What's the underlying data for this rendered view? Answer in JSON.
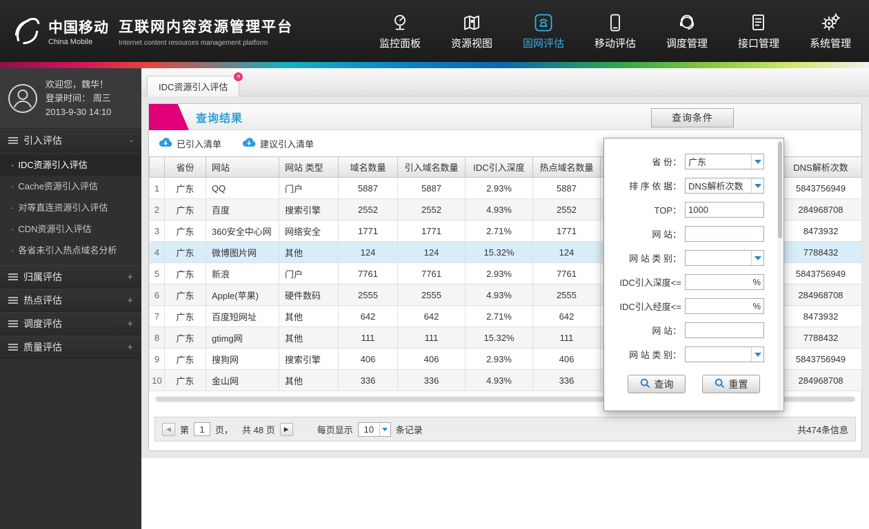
{
  "colors": {
    "accent_blue": "#2e9fd4",
    "accent_magenta": "#e2007a",
    "nav_active": "#36b3e6",
    "selected_row_bg": "#d9edf8"
  },
  "header": {
    "brand_cn": "中国移动",
    "brand_en": "China Mobile",
    "title_cn": "互联网内容资源管理平台",
    "title_en": "Internet content resources management platform",
    "nav": [
      {
        "label": "监控面板",
        "icon": "dashboard-icon",
        "active": false
      },
      {
        "label": "资源视图",
        "icon": "map-icon",
        "active": false
      },
      {
        "label": "固网评估",
        "icon": "phone-icon",
        "active": true
      },
      {
        "label": "移动评估",
        "icon": "mobile-icon",
        "active": false
      },
      {
        "label": "调度管理",
        "icon": "headset-icon",
        "active": false
      },
      {
        "label": "接口管理",
        "icon": "document-icon",
        "active": false
      },
      {
        "label": "系统管理",
        "icon": "gears-icon",
        "active": false
      }
    ]
  },
  "sidebar": {
    "user": {
      "welcome": "欢迎您，魏华！",
      "login_line1": "登录时间：  周三",
      "login_line2": "2013-9-30  14:10"
    },
    "sections": [
      {
        "label": "引入评估",
        "toggle": "-",
        "expanded": true,
        "items": [
          {
            "label": "IDC资源引入评估",
            "active": true
          },
          {
            "label": "Cache资源引入评估",
            "active": false
          },
          {
            "label": "对等直连资源引入评估",
            "active": false
          },
          {
            "label": "CDN资源引入评估",
            "active": false
          },
          {
            "label": "各省未引入热点域名分析",
            "active": false
          }
        ]
      },
      {
        "label": "归属评估",
        "toggle": "+",
        "expanded": false,
        "items": []
      },
      {
        "label": "热点评估",
        "toggle": "+",
        "expanded": false,
        "items": []
      },
      {
        "label": "调度评估",
        "toggle": "+",
        "expanded": false,
        "items": []
      },
      {
        "label": "质量评估",
        "toggle": "+",
        "expanded": false,
        "items": []
      }
    ]
  },
  "tabbar": {
    "tabs": [
      {
        "label": "IDC资源引入评估",
        "active": true,
        "closable": true
      }
    ]
  },
  "panel": {
    "title": "查询结果",
    "query_toggle_label": "查询条件",
    "toolbar_buttons": [
      {
        "label": "已引入清单",
        "icon": "cloud-download-icon"
      },
      {
        "label": "建议引入清单",
        "icon": "cloud-download-icon"
      }
    ]
  },
  "table": {
    "columns": [
      "",
      "省份",
      "网站",
      "网站 类型",
      "域名数量",
      "引入域名数量",
      "IDC引入深度",
      "热点域名数量",
      "",
      "DNS解析次数"
    ],
    "selected_index": 3,
    "rows": [
      [
        "1",
        "广东",
        "QQ",
        "门户",
        "5887",
        "5887",
        "2.93%",
        "5887",
        "",
        "5843756949"
      ],
      [
        "2",
        "广东",
        "百度",
        "搜索引擎",
        "2552",
        "2552",
        "4.93%",
        "2552",
        "",
        "284968708"
      ],
      [
        "3",
        "广东",
        "360安全中心网",
        "网络安全",
        "1771",
        "1771",
        "2.71%",
        "1771",
        "",
        "8473932"
      ],
      [
        "4",
        "广东",
        "微博图片网",
        "其他",
        "124",
        "124",
        "15.32%",
        "124",
        "",
        "7788432"
      ],
      [
        "5",
        "广东",
        "新浪",
        "门户",
        "7761",
        "7761",
        "2.93%",
        "7761",
        "",
        "5843756949"
      ],
      [
        "6",
        "广东",
        "Apple(苹果)",
        "硬件数码",
        "2555",
        "2555",
        "4.93%",
        "2555",
        "",
        "284968708"
      ],
      [
        "7",
        "广东",
        "百度短网址",
        "其他",
        "642",
        "642",
        "2.71%",
        "642",
        "",
        "8473932"
      ],
      [
        "8",
        "广东",
        "gtimg网",
        "其他",
        "111",
        "111",
        "15.32%",
        "111",
        "",
        "7788432"
      ],
      [
        "9",
        "广东",
        "搜狗网",
        "搜索引擎",
        "406",
        "406",
        "2.93%",
        "406",
        "",
        "5843756949"
      ],
      [
        "10",
        "广东",
        "金山网",
        "其他",
        "336",
        "336",
        "4.93%",
        "336",
        "",
        "284968708"
      ]
    ]
  },
  "query_panel": {
    "fields": [
      {
        "label": "省 份：",
        "type": "select",
        "value": "广东"
      },
      {
        "label": "排 序 依 据：",
        "type": "select",
        "value": "DNS解析次数"
      },
      {
        "label": "TOP：",
        "type": "input",
        "value": "1000"
      },
      {
        "label": "网 站：",
        "type": "input",
        "value": ""
      },
      {
        "label": "网 站 类 别：",
        "type": "select",
        "value": ""
      },
      {
        "label": "IDC引入深度<=",
        "type": "input",
        "value": "",
        "suffix": "%"
      },
      {
        "label": "IDC引入经度<=",
        "type": "input",
        "value": "",
        "suffix": "%"
      },
      {
        "label": "网 站：",
        "type": "input",
        "value": ""
      },
      {
        "label": "网 站 类 别：",
        "type": "select",
        "value": ""
      }
    ],
    "search_label": "查询",
    "reset_label": "重置"
  },
  "pagination": {
    "page_word_before": "第",
    "page_value": "1",
    "page_word_after": "页，",
    "total_pages": "共 48 页",
    "per_page_label": "每页显示",
    "per_page_value": "10",
    "per_page_suffix": "条记录",
    "total_info": "共474条信息"
  }
}
